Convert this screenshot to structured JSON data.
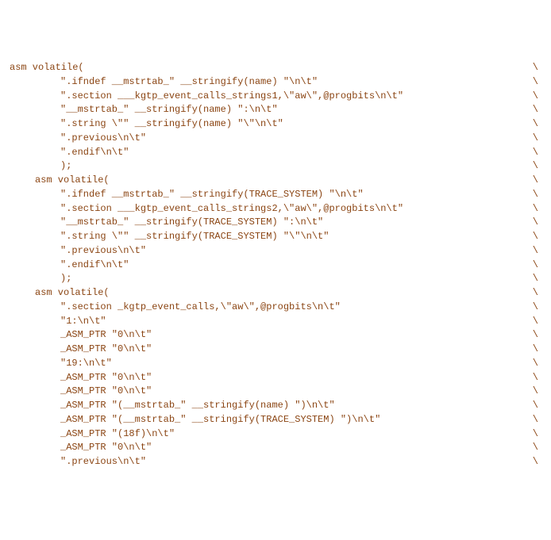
{
  "lines": [
    {
      "indent": 0,
      "text": "asm volatile(",
      "bslash": true
    },
    {
      "indent": 2,
      "text": "\".ifndef __mstrtab_\" __stringify(name) \"\\n\\t\"",
      "bslash": true
    },
    {
      "indent": 2,
      "text": "\".section ___kgtp_event_calls_strings1,\\\"aw\\\",@progbits\\n\\t\"",
      "bslash": true
    },
    {
      "indent": 2,
      "text": "\"__mstrtab_\" __stringify(name) \":\\n\\t\"",
      "bslash": true
    },
    {
      "indent": 2,
      "text": "\".string \\\"\" __stringify(name) \"\\\"\\n\\t\"",
      "bslash": true
    },
    {
      "indent": 2,
      "text": "\".previous\\n\\t\"",
      "bslash": true
    },
    {
      "indent": 2,
      "text": "\".endif\\n\\t\"",
      "bslash": true
    },
    {
      "indent": 2,
      "text": ");",
      "bslash": true
    },
    {
      "indent": 1,
      "text": "asm volatile(",
      "bslash": true
    },
    {
      "indent": 2,
      "text": "\".ifndef __mstrtab_\" __stringify(TRACE_SYSTEM) \"\\n\\t\"",
      "bslash": true
    },
    {
      "indent": 2,
      "text": "\".section ___kgtp_event_calls_strings2,\\\"aw\\\",@progbits\\n\\t\"",
      "bslash": true
    },
    {
      "indent": 2,
      "text": "\"__mstrtab_\" __stringify(TRACE_SYSTEM) \":\\n\\t\"",
      "bslash": true
    },
    {
      "indent": 2,
      "text": "\".string \\\"\" __stringify(TRACE_SYSTEM) \"\\\"\\n\\t\"",
      "bslash": true
    },
    {
      "indent": 2,
      "text": "\".previous\\n\\t\"",
      "bslash": true
    },
    {
      "indent": 2,
      "text": "\".endif\\n\\t\"",
      "bslash": true
    },
    {
      "indent": 2,
      "text": ");",
      "bslash": true
    },
    {
      "indent": 1,
      "text": "asm volatile(",
      "bslash": true
    },
    {
      "indent": 2,
      "text": "\".section _kgtp_event_calls,\\\"aw\\\",@progbits\\n\\t\"",
      "bslash": true
    },
    {
      "indent": 2,
      "text": "\"1:\\n\\t\"",
      "bslash": true
    },
    {
      "indent": 2,
      "text": "_ASM_PTR \"0\\n\\t\"",
      "bslash": true
    },
    {
      "indent": 2,
      "text": "_ASM_PTR \"0\\n\\t\"",
      "bslash": true
    },
    {
      "indent": 2,
      "text": "\"19:\\n\\t\"",
      "bslash": true
    },
    {
      "indent": 2,
      "text": "_ASM_PTR \"0\\n\\t\"",
      "bslash": true
    },
    {
      "indent": 2,
      "text": "_ASM_PTR \"0\\n\\t\"",
      "bslash": true
    },
    {
      "indent": 2,
      "text": "_ASM_PTR \"(__mstrtab_\" __stringify(name) \")\\n\\t\"",
      "bslash": true
    },
    {
      "indent": 2,
      "text": "_ASM_PTR \"(__mstrtab_\" __stringify(TRACE_SYSTEM) \")\\n\\t\"",
      "bslash": true
    },
    {
      "indent": 2,
      "text": "_ASM_PTR \"(18f)\\n\\t\"",
      "bslash": true
    },
    {
      "indent": 2,
      "text": "_ASM_PTR \"0\\n\\t\"",
      "bslash": true
    },
    {
      "indent": 2,
      "text": "\".previous\\n\\t\"",
      "bslash": true
    }
  ]
}
